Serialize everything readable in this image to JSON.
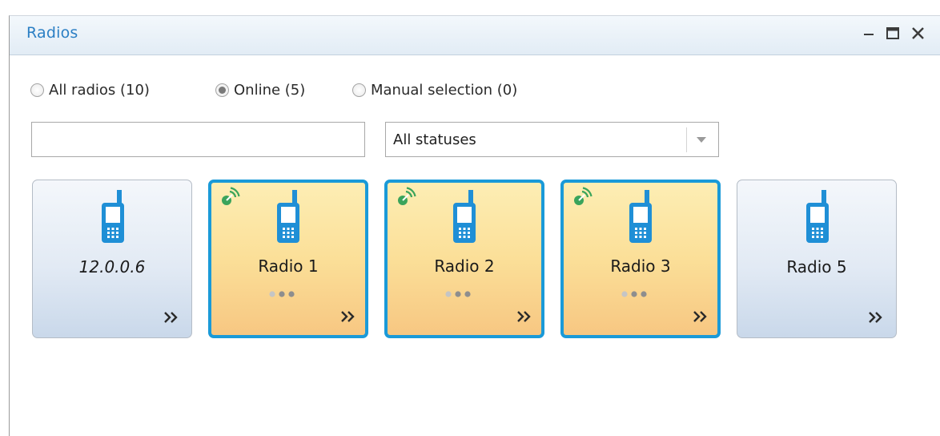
{
  "window": {
    "title": "Radios",
    "controls": {
      "minimize_icon": "minimize-icon",
      "maximize_icon": "maximize-icon",
      "close_icon": "close-icon"
    }
  },
  "filter": {
    "options": [
      {
        "label": "All radios (10)",
        "checked": false
      },
      {
        "label": "Online (5)",
        "checked": true
      },
      {
        "label": "Manual selection (0)",
        "checked": false
      }
    ],
    "search_value": "",
    "status_select": {
      "value": "All statuses"
    }
  },
  "colors": {
    "title": "#2b7fc4",
    "online_border": "#1a9ad8",
    "online_fill": "#fbdf98",
    "offline_fill": "#e2eaf4",
    "phone_icon": "#1f8fd6",
    "signal_icon": "#3aa45b"
  },
  "radios": [
    {
      "name": "12.0.0.6",
      "online": false,
      "has_status_dots": false,
      "italic": true
    },
    {
      "name": "Radio 1",
      "online": true,
      "has_status_dots": true,
      "italic": false
    },
    {
      "name": "Radio 2",
      "online": true,
      "has_status_dots": true,
      "italic": false
    },
    {
      "name": "Radio 3",
      "online": true,
      "has_status_dots": true,
      "italic": false
    },
    {
      "name": "Radio 5",
      "online": false,
      "has_status_dots": false,
      "italic": false
    }
  ]
}
